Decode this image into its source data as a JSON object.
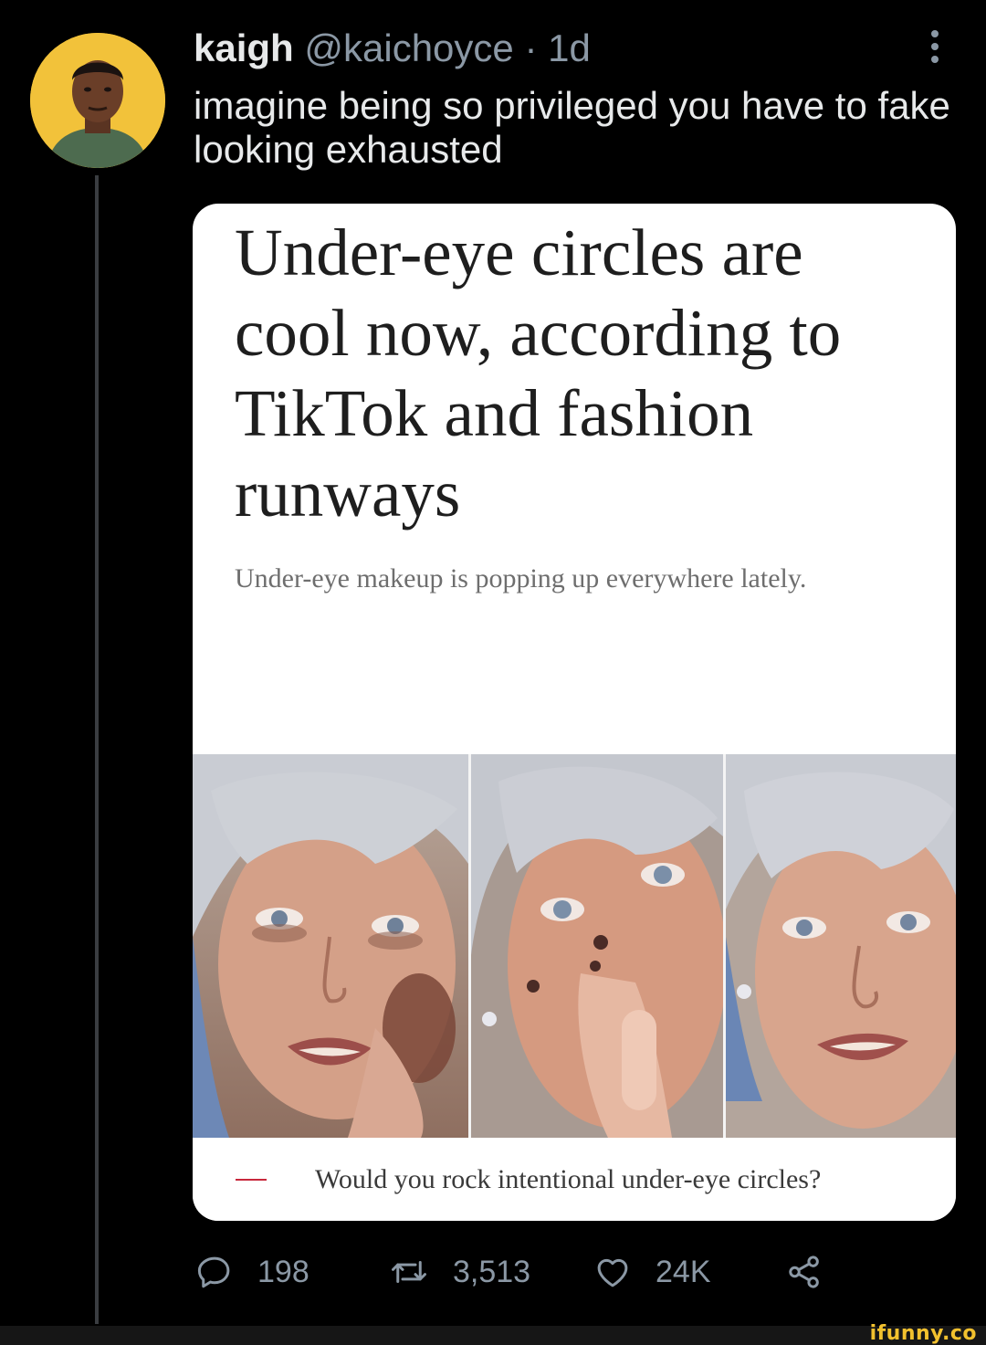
{
  "tweet": {
    "author_name": "kaigh",
    "author_handle": "@kaichoyce",
    "separator": "·",
    "timestamp": "1d",
    "text": "imagine being so privileged you have to fake looking exhausted"
  },
  "card": {
    "headline": "Under-eye circles are cool now, according to TikTok and fashion runways",
    "dek": "Under-eye makeup is popping up everywhere lately.",
    "caption": "Would you rock intentional under-eye circles?",
    "accent_color": "#c8283c"
  },
  "actions": {
    "replies": "198",
    "retweets": "3,513",
    "likes": "24K"
  },
  "icons": {
    "reply": "reply-icon",
    "retweet": "retweet-icon",
    "like": "heart-icon",
    "share": "share-icon",
    "more": "more-dots-icon"
  },
  "watermark": "ifunny.co",
  "colors": {
    "background": "#000000",
    "primary_text": "#e7e9ea",
    "secondary_text": "#8b98a5",
    "avatar_bg": "#f2c23a",
    "watermark": "#f2c12e"
  }
}
